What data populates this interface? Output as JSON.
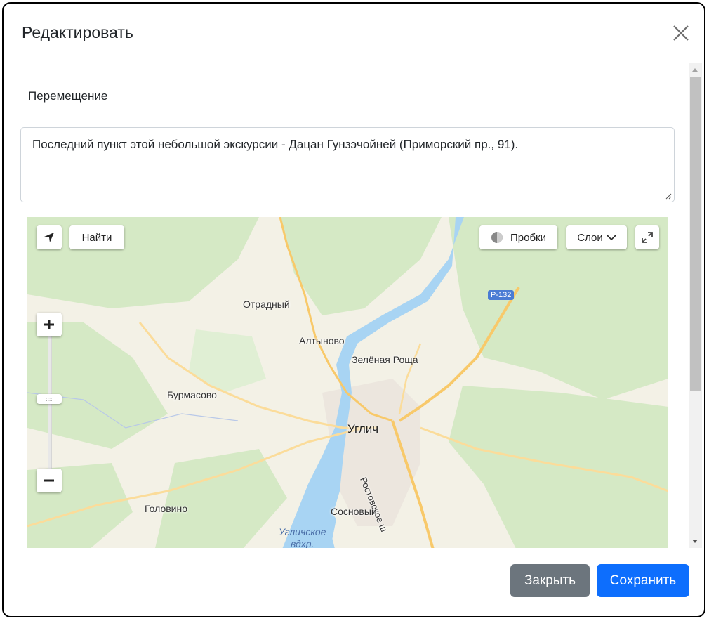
{
  "dialog": {
    "title": "Редактировать",
    "close_icon": "close-icon"
  },
  "form": {
    "label": "Перемещение",
    "text_value": "Последний пункт этой небольшой экскурсии - Дацан Гунзэчойней (Приморский пр., 91)."
  },
  "map": {
    "controls": {
      "geolocation_icon": "navigation-arrow-icon",
      "find_label": "Найти",
      "traffic_label": "Пробки",
      "layers_label": "Слои",
      "fullscreen_icon": "expand-icon",
      "zoom_in_icon": "plus-icon",
      "zoom_out_icon": "minus-icon"
    },
    "places": {
      "otradny": "Отрадный",
      "altynovo": "Алтыново",
      "zelenaya_roscha": "Зелёная Роща",
      "burmasovo": "Бурмасово",
      "uglich": "Углич",
      "rostovskoe": "Ростовское ш",
      "sosnovy": "Сосновый",
      "golovino": "Головино",
      "reservoir_line1": "Угличское",
      "reservoir_line2": "вдхр."
    },
    "road_shield": "Р-132",
    "colors": {
      "water": "#a8d4f3",
      "forest": "#d5e9c5",
      "land": "#f3f1e6",
      "road": "#f8c96a"
    }
  },
  "footer": {
    "close_label": "Закрыть",
    "save_label": "Сохранить"
  },
  "colors": {
    "secondary": "#6c757d",
    "primary": "#0d6efd"
  }
}
